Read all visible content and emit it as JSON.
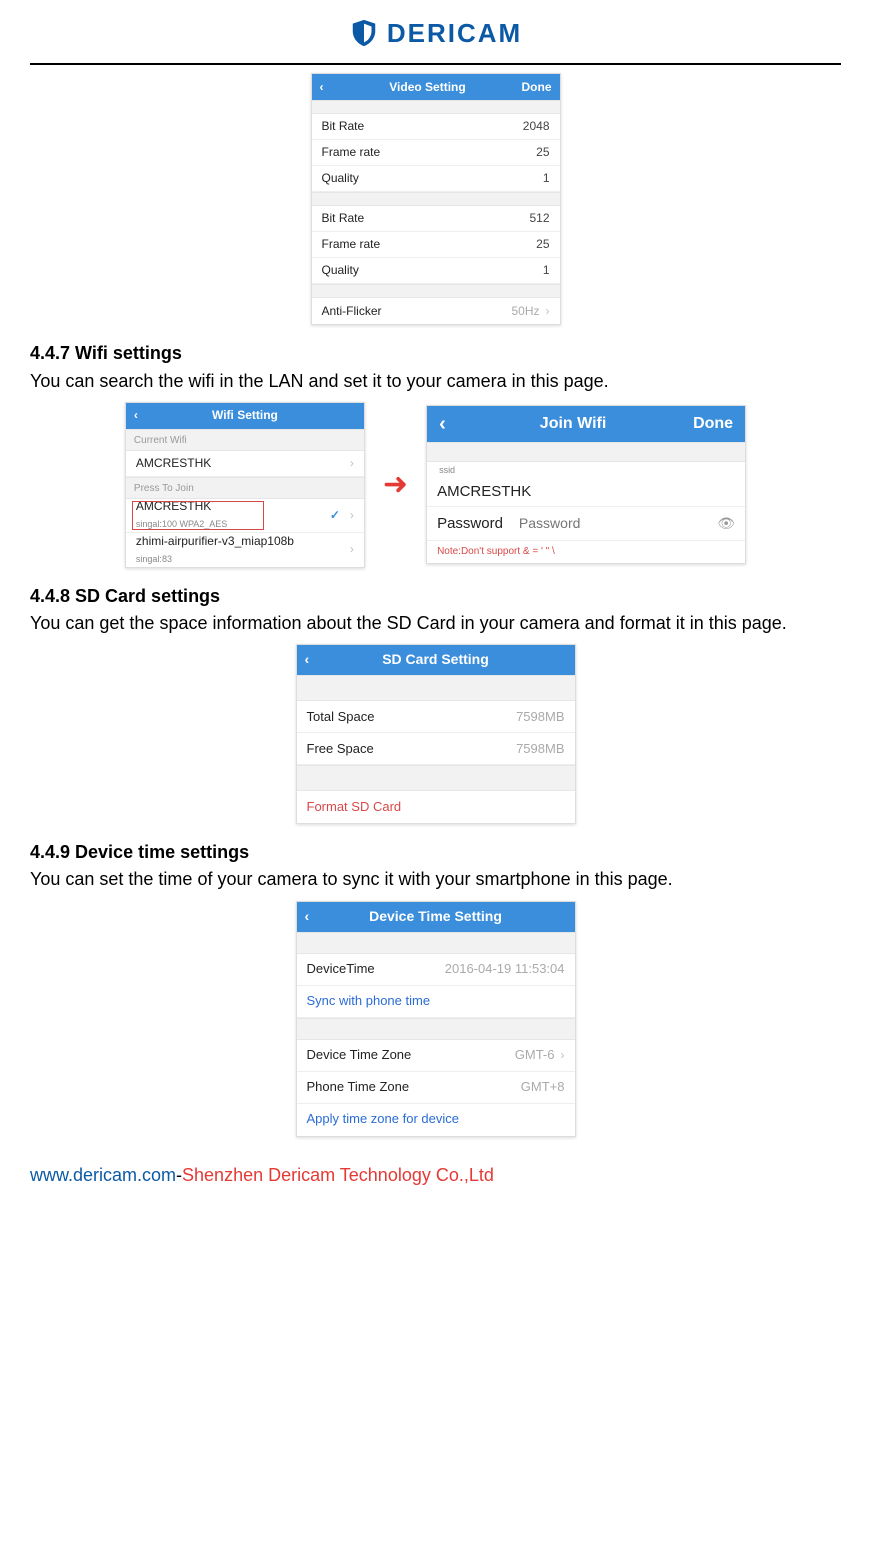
{
  "brand": {
    "name": "DERICAM"
  },
  "video_setting": {
    "title": "Video Setting",
    "done": "Done",
    "group1": {
      "bit_rate_label": "Bit Rate",
      "bit_rate": "2048",
      "frame_rate_label": "Frame rate",
      "frame_rate": "25",
      "quality_label": "Quality",
      "quality": "1"
    },
    "group2": {
      "bit_rate_label": "Bit Rate",
      "bit_rate": "512",
      "frame_rate_label": "Frame rate",
      "frame_rate": "25",
      "quality_label": "Quality",
      "quality": "1"
    },
    "anti_flicker_label": "Anti-Flicker",
    "anti_flicker": "50Hz"
  },
  "s447": {
    "heading": "4.4.7 Wifi settings",
    "desc": "You can search the wifi in the LAN and set it to your camera in this page."
  },
  "wifi_setting": {
    "title": "Wifi Setting",
    "current_label": "Current Wifi",
    "current": "AMCRESTHK",
    "press_label": "Press To Join",
    "net1_name": "AMCRESTHK",
    "net1_sub": "singal:100   WPA2_AES",
    "net2_name": "zhimi-airpurifier-v3_miap108b",
    "net2_sub": "singal:83"
  },
  "join_wifi": {
    "title": "Join Wifi",
    "done": "Done",
    "ssid_label": "ssid",
    "ssid": "AMCRESTHK",
    "password_label": "Password",
    "password_placeholder": "Password",
    "note": "Note:Don't support & = ' \" \\"
  },
  "s448": {
    "heading": "4.4.8 SD Card settings",
    "desc": "You can get the space information about the SD Card in your camera and format it in this page."
  },
  "sd": {
    "title": "SD Card Setting",
    "total_label": "Total Space",
    "total": "7598MB",
    "free_label": "Free Space",
    "free": "7598MB",
    "format": "Format SD Card"
  },
  "s449": {
    "heading": "4.4.9 Device time settings",
    "desc": "You can set the time of your camera to sync it with your smartphone in this page."
  },
  "time": {
    "title": "Device Time Setting",
    "device_time_label": "DeviceTime",
    "device_time": "2016-04-19  11:53:04",
    "sync": "Sync with phone time",
    "device_zone_label": "Device Time Zone",
    "device_zone": "GMT-6",
    "phone_zone_label": "Phone Time Zone",
    "phone_zone": "GMT+8",
    "apply": "Apply time zone for device"
  },
  "footer": {
    "url": "www.dericam.com",
    "dash": "-",
    "company": "Shenzhen Dericam Technology Co.,Ltd"
  }
}
